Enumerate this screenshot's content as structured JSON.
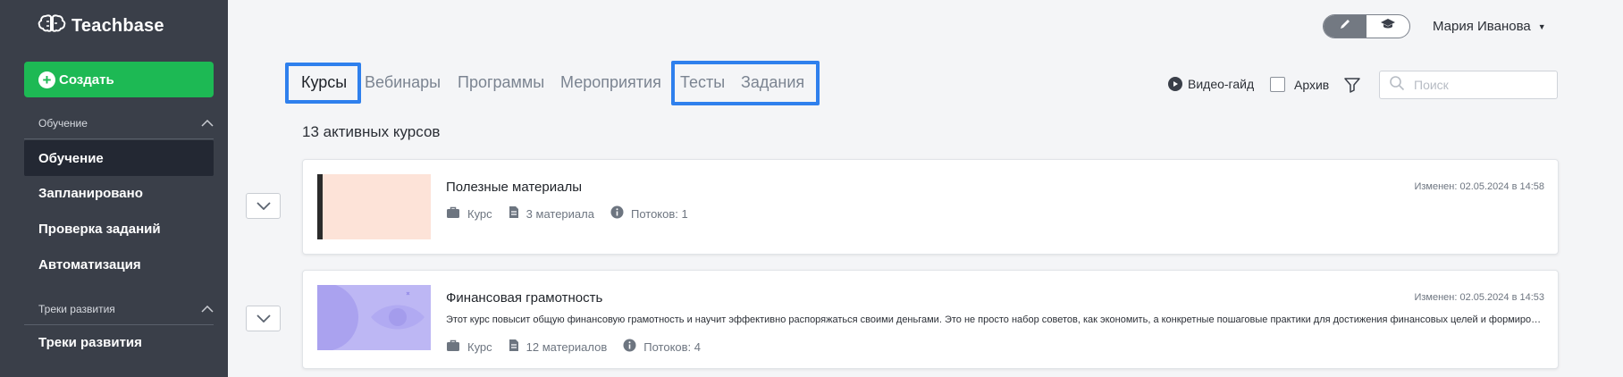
{
  "sidebar": {
    "logo": "Teachbase",
    "create_label": "Создать",
    "sections": [
      {
        "title": "Обучение",
        "items": [
          "Обучение",
          "Запланировано",
          "Проверка заданий",
          "Автоматизация"
        ]
      },
      {
        "title": "Треки развития",
        "items": [
          "Треки развития"
        ]
      }
    ]
  },
  "header": {
    "user_name": "Мария Иванова"
  },
  "tabs": [
    "Курсы",
    "Вебинары",
    "Программы",
    "Мероприятия",
    "Тесты",
    "Задания"
  ],
  "toolbar": {
    "video_guide": "Видео-гайд",
    "archive": "Архив",
    "search_placeholder": "Поиск"
  },
  "count_label": "13 активных курсов",
  "courses": [
    {
      "title": "Полезные материалы",
      "modified": "Изменен: 02.05.2024 в 14:58",
      "description": "",
      "type": "Курс",
      "materials": "3 материала",
      "streams": "Потоков: 1"
    },
    {
      "title": "Финансовая грамотность",
      "modified": "Изменен: 02.05.2024 в 14:53",
      "description": "Этот курс повысит общую финансовую грамотность и научит эффективно распоряжаться своими деньгами. Это не просто набор советов, как экономить, а конкретные пошаговые практики для достижения финансовых целей и формирования правильных привычек",
      "type": "Курс",
      "materials": "12 материалов",
      "streams": "Потоков: 4"
    }
  ],
  "colors": {
    "sidebar_bg": "#3a3f49",
    "accent_green": "#1db954",
    "highlight_blue": "#2f80ed"
  }
}
